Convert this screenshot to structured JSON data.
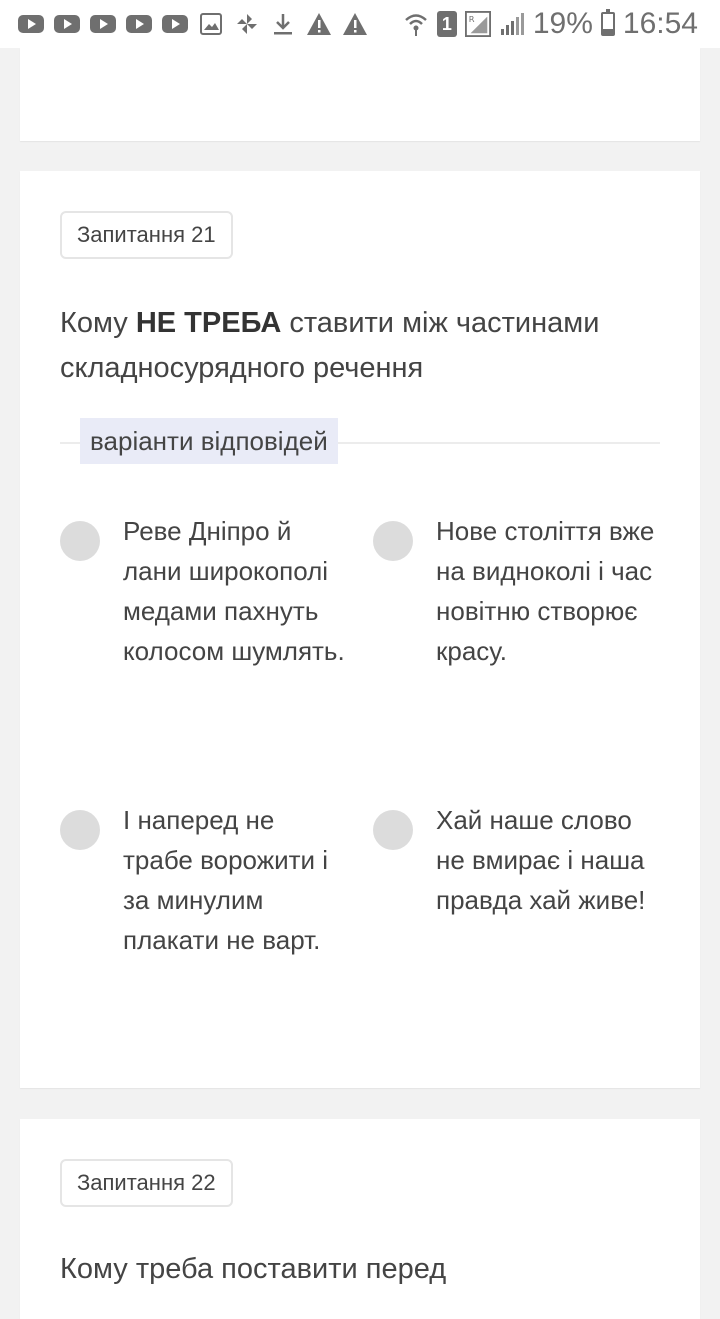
{
  "status_bar": {
    "notification_icons": [
      "youtube-icon",
      "youtube-icon",
      "youtube-icon",
      "youtube-icon",
      "youtube-icon",
      "image-icon",
      "pinwheel-icon",
      "download-icon",
      "warning-icon",
      "warning-icon"
    ],
    "sim_label": "1",
    "battery": "19%",
    "time": "16:54"
  },
  "question21": {
    "badge": "Запитання 21",
    "text_prefix": "Кому ",
    "text_bold": "НЕ ТРЕБА",
    "text_suffix": " ставити між частинами складносурядного речення",
    "variants_label": "варіанти відповідей",
    "options": [
      "Реве Дніпро й лани широкополі медами пахнуть колосом шумлять.",
      "Нове століття вже на видноколі і час новітню створює красу.",
      "І наперед не трабе ворожити і за минулим плакати не варт.",
      "Хай наше слово не вмирає і наша правда хай живе!"
    ]
  },
  "question22": {
    "badge": "Запитання 22",
    "text": "Кому треба поставити перед"
  }
}
